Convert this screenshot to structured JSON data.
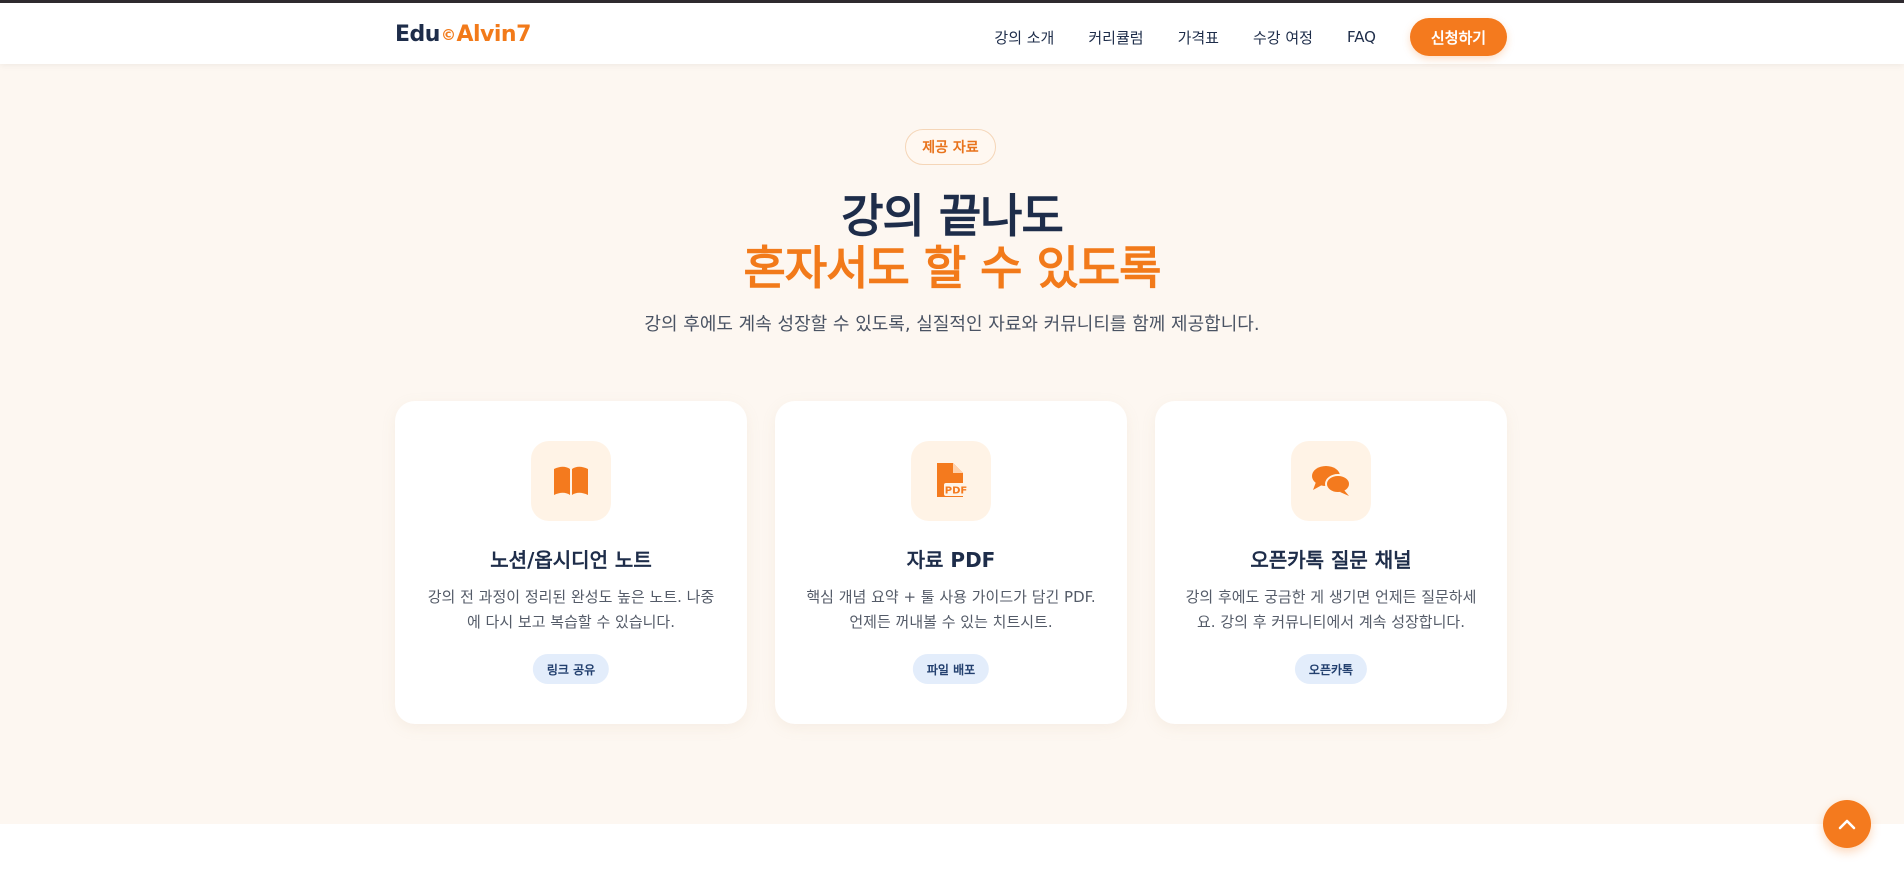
{
  "header": {
    "logo": {
      "part1": "Edu",
      "part2": "©",
      "part3": "Alvin7"
    },
    "nav": [
      "강의 소개",
      "커리큘럼",
      "가격표",
      "수강 여정",
      "FAQ"
    ],
    "cta_label": "신청하기"
  },
  "section": {
    "badge": "제공 자료",
    "title_line1": "강의 끝나도",
    "title_line2": "혼자서도 할 수 있도록",
    "subtitle": "강의 후에도 계속 성장할 수 있도록, 실질적인 자료와 커뮤니티를 함께 제공합니다."
  },
  "cards": [
    {
      "icon": "book-open-icon",
      "title": "노션/옵시디언 노트",
      "desc_line1": "강의 전 과정이 정리된 완성도 높은 노트. 나중",
      "desc_line2": "에 다시 보고 복습할 수 있습니다.",
      "tag": "링크 공유"
    },
    {
      "icon": "pdf-file-icon",
      "title": "자료 PDF",
      "desc_line1": "핵심 개념 요약 + 툴 사용 가이드가 담긴 PDF.",
      "desc_line2": "언제든 꺼내볼 수 있는 치트시트.",
      "tag": "파일 배포"
    },
    {
      "icon": "chat-bubbles-icon",
      "title": "오픈카톡 질문 채널",
      "desc_line1": "강의 후에도 궁금한 게 생기면 언제든 질문하세",
      "desc_line2": "요. 강의 후 커뮤니티에서 계속 성장합니다.",
      "tag": "오픈카톡"
    }
  ],
  "colors": {
    "accent": "#f47a1e",
    "navy": "#1e2d4a",
    "background": "#fdf7f1",
    "pill": "#e3edfb"
  }
}
